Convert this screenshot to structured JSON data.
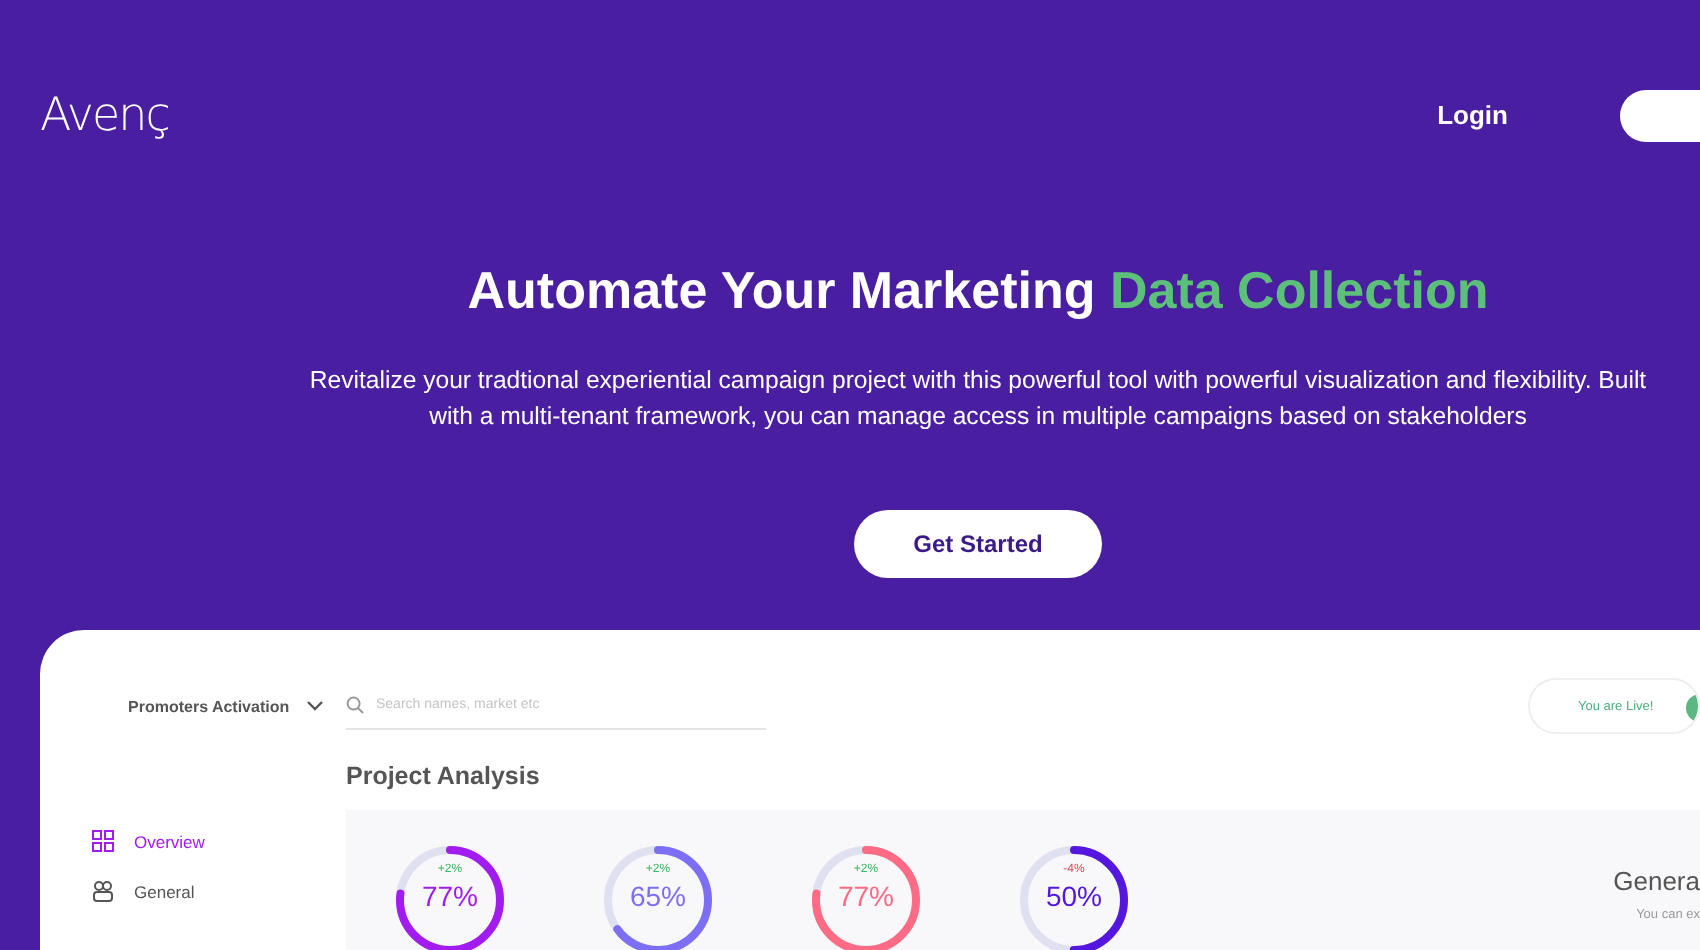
{
  "header": {
    "logo": "Avenç",
    "login": "Login"
  },
  "hero": {
    "title": "Automate Your Marketing **Data Collection**",
    "subtitle": "Revitalize your tradtional experiential campaign project with this powerful tool with powerful visualization and flexibility. Built with a multi-tenant framework, you can manage access in multiple campaigns based on stakeholders",
    "cta": "Get Started"
  },
  "dashboard": {
    "project": "Promoters Activation",
    "search": {
      "placeholder": "Search names, market etc"
    },
    "live": {
      "label": "You are Live!",
      "on": true
    },
    "sidebar": [
      {
        "label": "Overview",
        "selected": true
      },
      {
        "label": "General",
        "selected": false
      }
    ],
    "section_title": "Project Analysis",
    "meters": [
      {
        "kind": "gain",
        "delta": "+2%",
        "value": "77%",
        "level": 0.77,
        "color": "#a21cf0"
      },
      {
        "kind": "gain",
        "delta": "+2%",
        "value": "65%",
        "level": 0.65,
        "color": "#7d6ff5"
      },
      {
        "kind": "gain",
        "delta": "+2%",
        "value": "77%",
        "level": 0.77,
        "color": "#ff6b84"
      },
      {
        "kind": "loss",
        "delta": "-4%",
        "value": "50%",
        "level": 0.5,
        "color": "#5516e0"
      }
    ],
    "side_panel": {
      "title": "Genera",
      "text": "You can ex"
    }
  }
}
